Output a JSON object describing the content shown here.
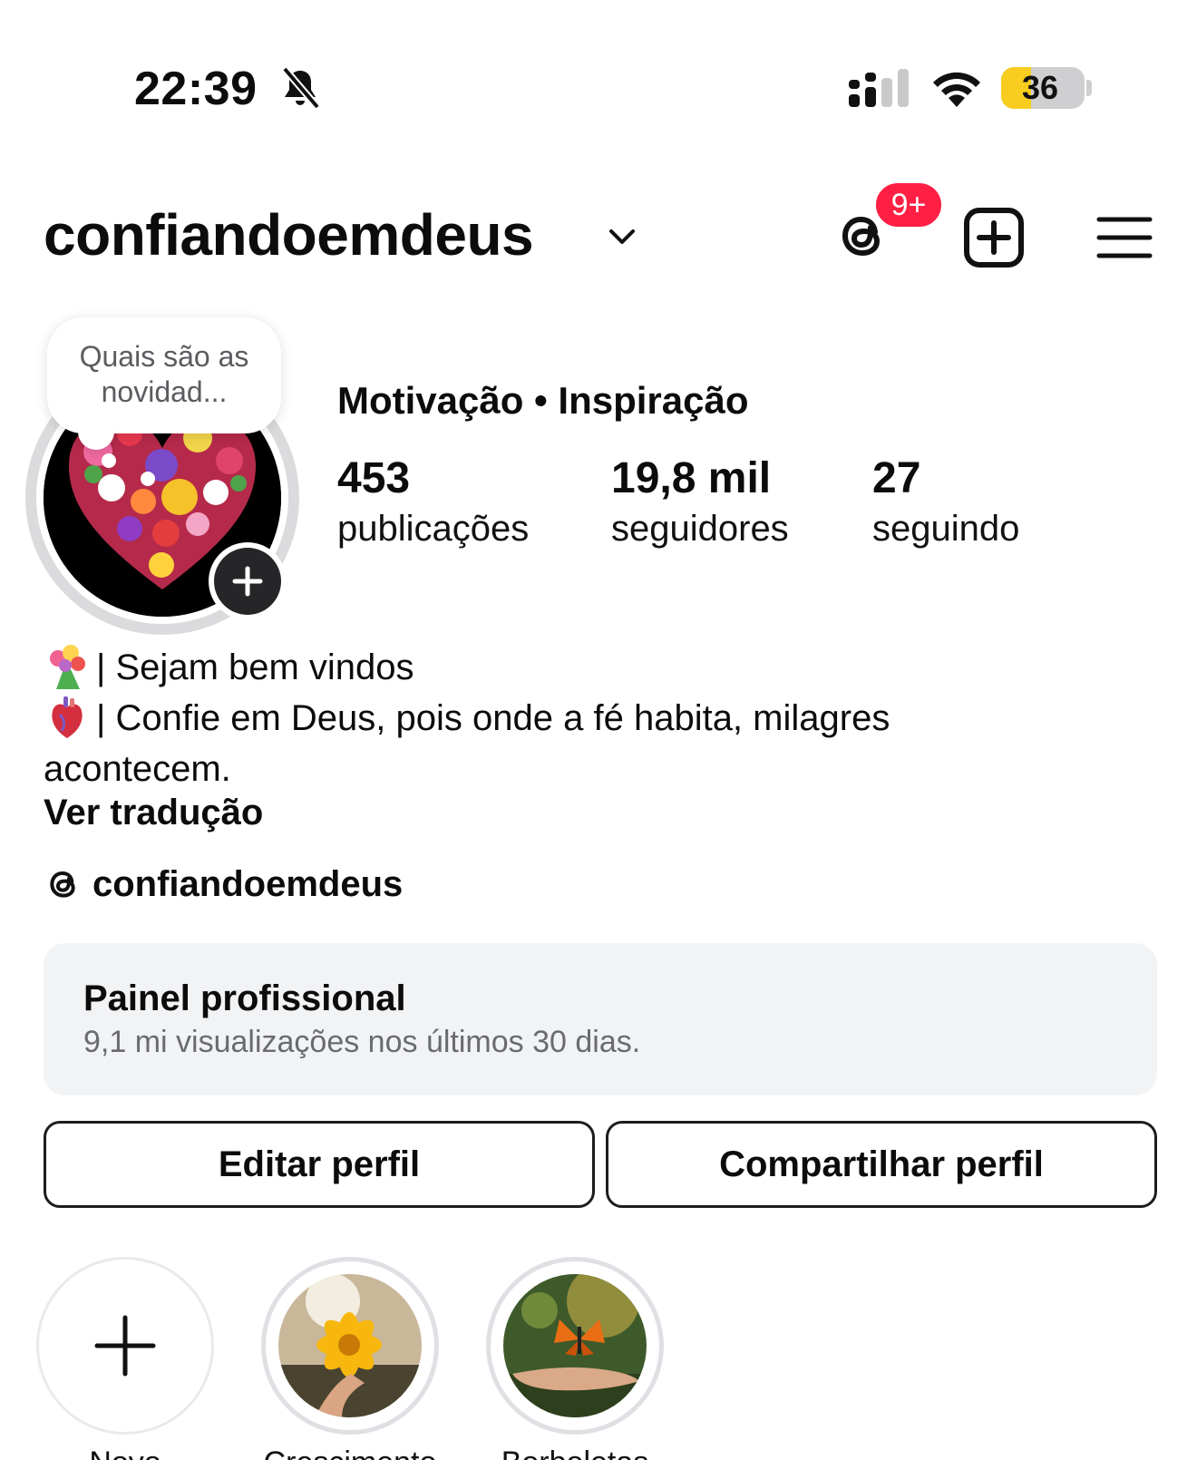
{
  "status_bar": {
    "time": "22:39",
    "battery_level": "36",
    "battery_percent": 36
  },
  "header": {
    "username": "confiandoemdeus",
    "threads_badge": "9+"
  },
  "note": {
    "text": "Quais são as novidad..."
  },
  "profile": {
    "category": "Motivação • Inspiração",
    "stats": [
      {
        "value": "453",
        "label": "publicações"
      },
      {
        "value": "19,8 mil",
        "label": "seguidores"
      },
      {
        "value": "27",
        "label": "seguindo"
      }
    ],
    "bio_line1": "| Sejam bem vindos",
    "bio_line2": "| Confie em Deus, pois onde a fé habita, milagres",
    "bio_line3": "acontecem.",
    "translate": "Ver tradução",
    "threads_handle": "confiandoemdeus"
  },
  "dashboard": {
    "title": "Painel profissional",
    "subtitle": "9,1 mi visualizações nos últimos 30 dias."
  },
  "buttons": {
    "edit": "Editar perfil",
    "share": "Compartilhar perfil"
  },
  "highlights": [
    {
      "label": "Novo"
    },
    {
      "label": "Crescimento"
    },
    {
      "label": "Borboletas"
    }
  ],
  "colors": {
    "badge": "#ff1f44",
    "battery": "#f8cd1f",
    "dashboard_bg": "#f2f3f5"
  }
}
